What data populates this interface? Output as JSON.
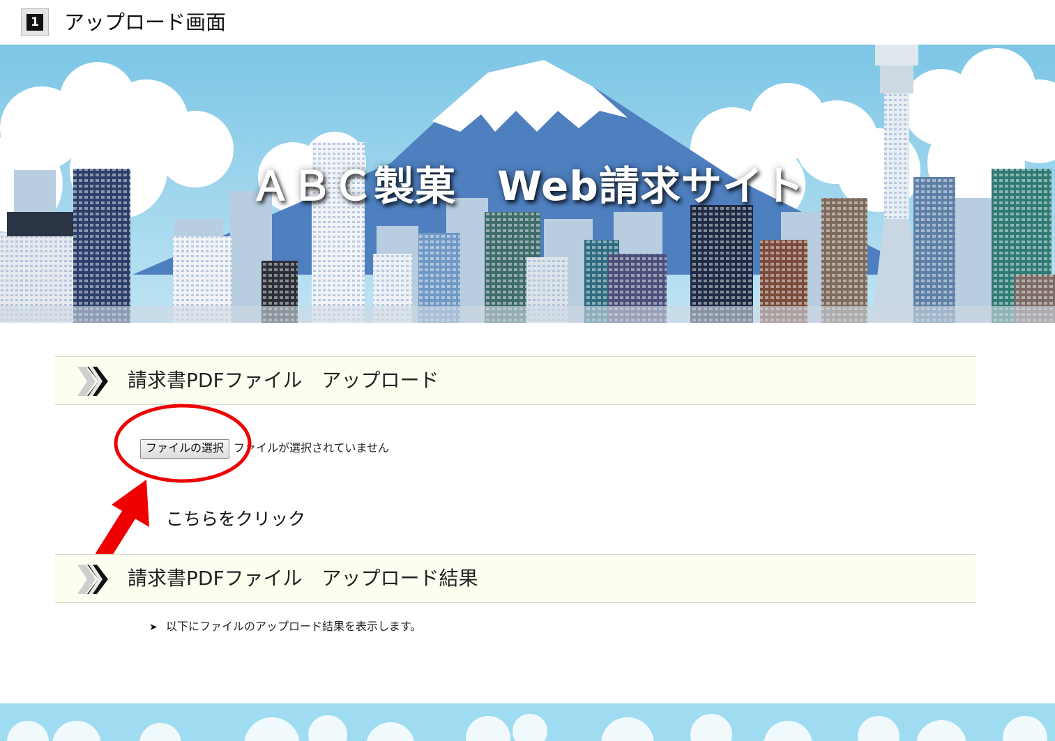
{
  "header": {
    "step_number": "1",
    "title": "アップロード画面"
  },
  "banner": {
    "title": "ＡＢＣ製菓　Web請求サイト"
  },
  "upload_section": {
    "title": "請求書PDFファイル　アップロード",
    "file_button_label": "ファイルの選択",
    "file_status": "ファイルが選択されていません"
  },
  "annotation": {
    "label": "こちらをクリック",
    "color": "#ee0000"
  },
  "result_section": {
    "title": "請求書PDFファイル　アップロード結果",
    "bullet": "➤",
    "message": "以下にファイルのアップロード結果を表示します。"
  },
  "colors": {
    "section_bg": "#fdfdf0",
    "sky": "#8fd0ea",
    "mountain": "#4e7fbf"
  }
}
